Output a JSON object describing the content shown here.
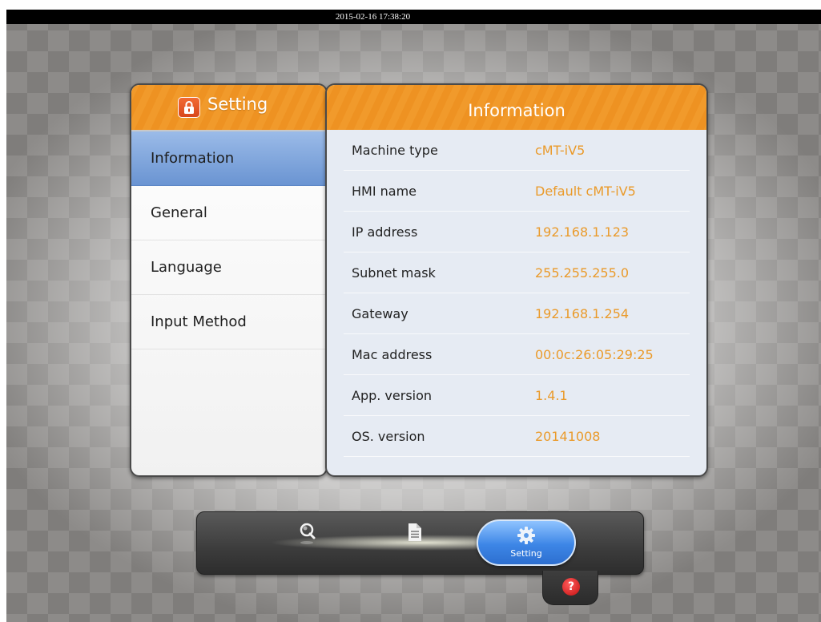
{
  "status_bar": {
    "datetime": "2015-02-16 17:38:20"
  },
  "settings_panel": {
    "title": "Setting",
    "icon": "lock-icon",
    "menu": [
      {
        "label": "Information",
        "active": true
      },
      {
        "label": "General",
        "active": false
      },
      {
        "label": "Language",
        "active": false
      },
      {
        "label": "Input Method",
        "active": false
      }
    ]
  },
  "info_panel": {
    "title": "Information",
    "rows": [
      {
        "label": "Machine type",
        "value": "cMT-iV5"
      },
      {
        "label": "HMI name",
        "value": "Default cMT-iV5"
      },
      {
        "label": "IP address",
        "value": "192.168.1.123"
      },
      {
        "label": "Subnet mask",
        "value": "255.255.255.0"
      },
      {
        "label": "Gateway",
        "value": "192.168.1.254"
      },
      {
        "label": "Mac address",
        "value": "00:0c:26:05:29:25"
      },
      {
        "label": "App. version",
        "value": "1.4.1"
      },
      {
        "label": "OS. version",
        "value": "20141008"
      }
    ]
  },
  "dock": {
    "items": [
      {
        "icon": "search-icon"
      },
      {
        "icon": "document-icon"
      },
      {
        "icon": "gear-icon",
        "label": "Setting",
        "active": true
      }
    ],
    "help": {
      "icon": "help-icon",
      "symbol": "?"
    }
  },
  "colors": {
    "accent_orange": "#ef9526",
    "value_text": "#ea9a2a",
    "active_menu": "#7aa0d8",
    "setting_button": "#3d86e6"
  }
}
